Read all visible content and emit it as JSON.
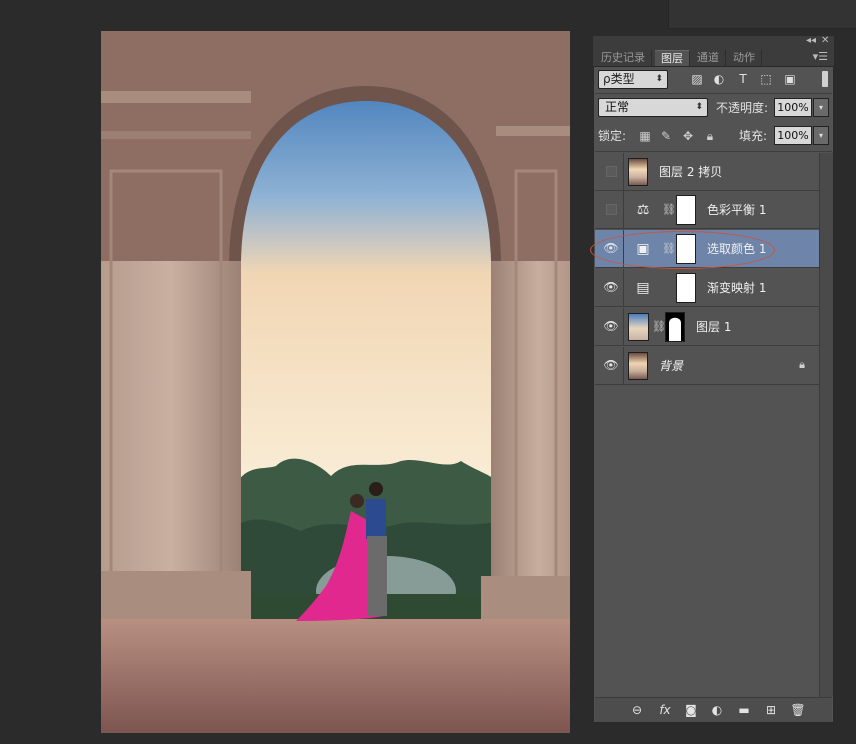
{
  "panel": {
    "header_controls": {
      "collapse": "◂◂",
      "close": "✕"
    },
    "tabs": [
      {
        "label": "历史记录",
        "active": false
      },
      {
        "label": "图层",
        "active": true
      },
      {
        "label": "通道",
        "active": false
      },
      {
        "label": "动作",
        "active": false
      }
    ],
    "tab_menu_icon": "panel-menu-icon",
    "filter": {
      "label": "ρ类型",
      "caret": "⬍"
    },
    "filter_icons": [
      "image-filter-icon",
      "adjustment-filter-icon",
      "type-filter-icon",
      "shape-filter-icon",
      "smart-object-filter-icon"
    ],
    "blend_mode": {
      "value": "正常",
      "caret": "⬍"
    },
    "opacity": {
      "label": "不透明度:",
      "value": "100%"
    },
    "lock": {
      "label": "锁定:",
      "icons": [
        "lock-transparent-icon",
        "lock-paint-icon",
        "lock-move-icon",
        "lock-all-icon"
      ]
    },
    "fill": {
      "label": "填充:",
      "value": "100%"
    }
  },
  "layers": [
    {
      "name": "图层 2 拷贝",
      "visible": false,
      "kind": "pixel",
      "selected": false
    },
    {
      "name": "色彩平衡 1",
      "visible": false,
      "kind": "adjustment",
      "icon": "⚖",
      "selected": false
    },
    {
      "name": "选取颜色 1",
      "visible": true,
      "kind": "adjustment",
      "icon": "▣",
      "selected": true
    },
    {
      "name": "渐变映射 1",
      "visible": true,
      "kind": "adjustment",
      "icon": "▤",
      "selected": false
    },
    {
      "name": "图层 1",
      "visible": true,
      "kind": "pixel-mask",
      "selected": false
    },
    {
      "name": "背景",
      "visible": true,
      "kind": "background",
      "locked": true,
      "selected": false
    }
  ],
  "bottom_icons": [
    "link-layers-icon",
    "fx-icon",
    "add-mask-icon",
    "new-adjustment-icon",
    "new-group-icon",
    "new-layer-icon",
    "delete-layer-icon"
  ],
  "bottom_glyphs": {
    "link": "⊖",
    "fx": "fx",
    "mask": "◙",
    "adjustment": "◐",
    "group": "▬",
    "new": "⊞",
    "trash": "🗑"
  },
  "colors": {
    "panel_bg": "#535353",
    "selected_layer": "#6e85a9",
    "annotation": "#c8543e",
    "dress": "#e0288f",
    "sky_top": "#3f79b8"
  }
}
